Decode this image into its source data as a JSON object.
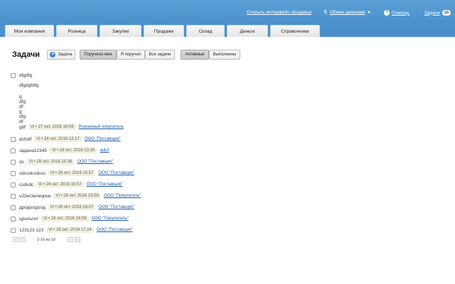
{
  "header": {
    "interface_link": "Открыть интерфейс продавца",
    "exchange_label": "Обмен данными",
    "help_label": "Помощь",
    "tasks_label": "Задачи",
    "tasks_count": "10"
  },
  "tabs": [
    "Моя компания",
    "Розница",
    "Закупки",
    "Продажи",
    "Склад",
    "Деньги",
    "Справочники"
  ],
  "page": {
    "title": "Задачи",
    "add_button": "Задача",
    "filter_assigned_to_me": "Поручено мне",
    "filter_i_assigned": "Я поручил",
    "filter_all": "Все задачи",
    "filter_active": "Активные",
    "filter_done": "Выполнены"
  },
  "tasks": [
    {
      "text": "dfgdfg",
      "lines": [
        "dfgdgfdfg",
        "",
        "g",
        "dfg",
        "df",
        "g",
        "dfg",
        "df",
        "gdf"
      ],
      "author": "Vi",
      "date": "27 окт. 2016 16:08",
      "counterparty": "Розничный покупатель"
    },
    {
      "text": "dsfsdf",
      "author": "Vi",
      "date": "28 окт. 2016 13:17",
      "counterparty": "ООО \"Поставщик\""
    },
    {
      "text": "задача12345",
      "author": "Vi",
      "date": "28 окт. 2016 13:35",
      "counterparty": "auk2"
    },
    {
      "text": "ds",
      "author": "Vi",
      "date": "28 окт. 2016 15:36",
      "counterparty": "ООО \"Поставщик\""
    },
    {
      "text": "sdcsdcsdcsc",
      "author": "Vi",
      "date": "28 окт. 2016 15:57",
      "counterparty": "ООО \"Поставщик\""
    },
    {
      "text": "csdsdc",
      "author": "Vi",
      "date": "28 окт. 2016 15:57",
      "counterparty": "ООО \"Поставщик\""
    },
    {
      "text": "v23er3erwqrew",
      "author": "Vi",
      "date": "28 окт. 2016 15:58",
      "counterparty": "ООО \"Покупатель\""
    },
    {
      "text": "дродолдолд",
      "author": "Vi",
      "date": "28 окт. 2016 16:07",
      "counterparty": "ООО \"Поставщик\""
    },
    {
      "text": "црольтит",
      "author": "Vi",
      "date": "28 окт. 2016 16:08",
      "counterparty": "ООО \"Покупатель\""
    },
    {
      "text": "123123 123",
      "author": "Vi",
      "date": "28 окт. 2016 17:24",
      "counterparty": "ООО \"Поставщик\""
    }
  ],
  "pager": {
    "summary": "1-10 из 10"
  },
  "colors": {
    "header_bg": "#4a8fc8",
    "link": "#1f5aa6",
    "badge_bg": "#f2eedd"
  }
}
